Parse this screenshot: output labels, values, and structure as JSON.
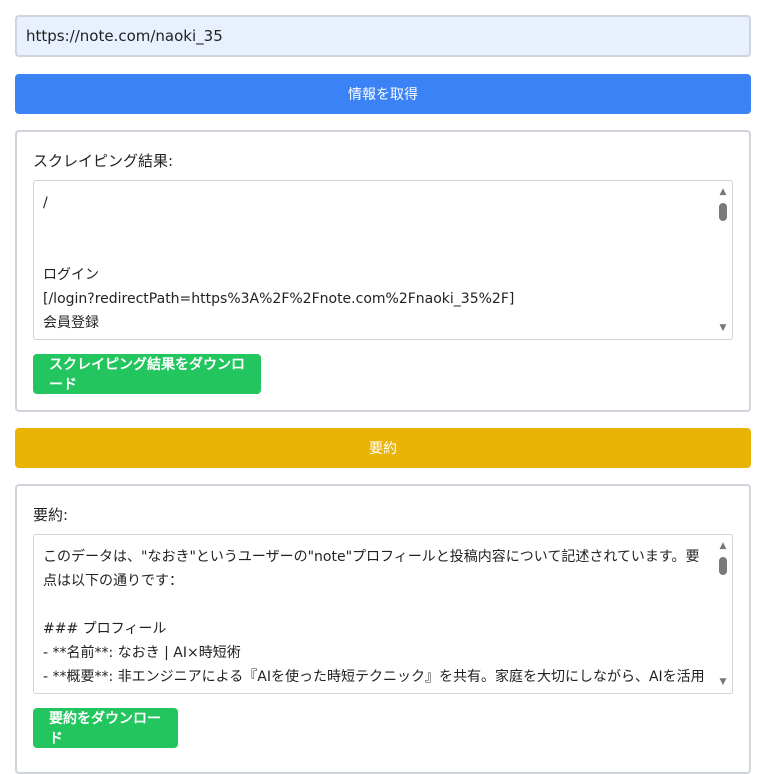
{
  "url_input": {
    "value": "https://note.com/naoki_35"
  },
  "fetch_button": {
    "label": "情報を取得"
  },
  "scrape_panel": {
    "label": "スクレイピング結果:",
    "content": "/\n\n\nログイン\n[/login?redirectPath=https%3A%2F%2Fnote.com%2Fnaoki_35%2F]\n会員登録",
    "download_label": "スクレイピング結果をダウンロード"
  },
  "summarize_button": {
    "label": "要約"
  },
  "summary_panel": {
    "label": "要約:",
    "content": "このデータは、\"なおき\"というユーザーの\"note\"プロフィールと投稿内容について記述されています。要点は以下の通りです：\n\n### プロフィール\n- **名前**: なおき | AI×時短術\n- **概要**: 非エンジニアによる『AIを使った時短テクニック』を共有。家庭を大切にしながら、AIを活用して",
    "download_label": "要約をダウンロード"
  },
  "icons": {
    "scroll_up": "scroll-up-arrow",
    "scroll_down": "scroll-down-arrow"
  },
  "colors": {
    "primary_blue": "#3b82f6",
    "summary_yellow": "#eab308",
    "download_green": "#22c55e",
    "input_bg": "#e8f0fe"
  }
}
